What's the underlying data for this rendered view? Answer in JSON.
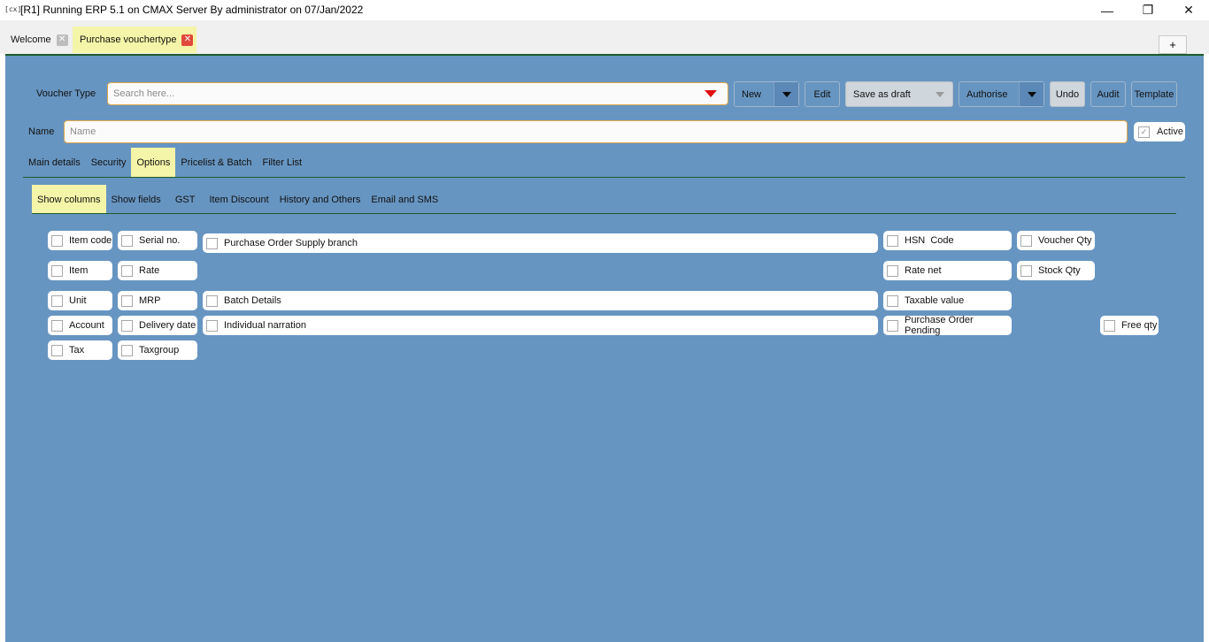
{
  "window": {
    "title": "[R1] Running ERP 5.1 on CMAX Server By administrator on 07/Jan/2022",
    "app_icon_text": "[cx]",
    "minimize_glyph": "—",
    "restore_glyph": "❐",
    "close_glyph": "✕"
  },
  "tabs": {
    "items": [
      {
        "label": "Welcome",
        "close": "✕"
      },
      {
        "label": "Purchase vouchertype",
        "close": "✕"
      }
    ],
    "new_tab": "+"
  },
  "toolbar": {
    "voucher_type_label": "Voucher Type",
    "search_placeholder": "Search here...",
    "new_label": "New",
    "edit_label": "Edit",
    "save_draft_label": "Save as draft",
    "authorise_label": "Authorise",
    "undo_label": "Undo",
    "audit_label": "Audit",
    "template_label": "Template"
  },
  "name_row": {
    "label": "Name",
    "placeholder": "Name",
    "active_label": "Active",
    "active_checked": true
  },
  "main_tabs": [
    "Main details",
    "Security",
    "Options",
    "Pricelist & Batch",
    "Filter List"
  ],
  "main_tabs_selected": "Options",
  "sub_tabs": [
    "Show columns",
    "Show fields",
    "GST",
    "Item Discount",
    "History and Others",
    "Email and SMS"
  ],
  "sub_tabs_selected": "Show columns",
  "options": {
    "item_code": "Item code",
    "serial_no": "Serial no.",
    "po_supply_branch": "Purchase Order Supply branch",
    "hsn_code": "HSN  Code",
    "voucher_qty": "Voucher Qty",
    "item": "Item",
    "rate": "Rate",
    "rate_net": "Rate net",
    "stock_qty": "Stock Qty",
    "unit": "Unit",
    "mrp": "MRP",
    "batch_details": "Batch Details",
    "taxable_value": "Taxable value",
    "account": "Account",
    "delivery_date": "Delivery date",
    "individual_narration": "Individual narration",
    "po_pending": "Purchase Order Pending",
    "free_qty": "Free qty",
    "tax": "Tax",
    "taxgroup": "Taxgroup"
  },
  "colors": {
    "panel_bg": "#6795c1",
    "highlight_tab": "#f4f5a8",
    "accent_border": "#e0a64a",
    "rule": "#1e5a2a"
  }
}
